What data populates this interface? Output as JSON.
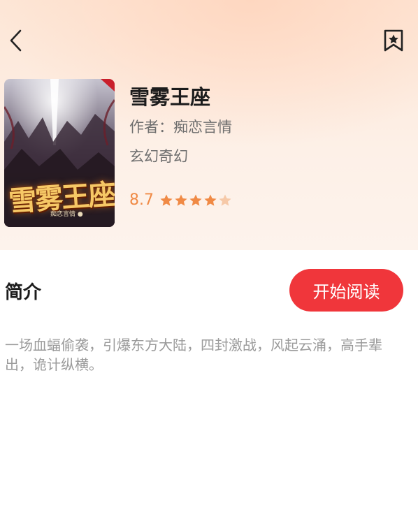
{
  "nav": {
    "back_icon": "chevron-left-icon",
    "bookmark_icon": "bookmark-star-icon"
  },
  "book": {
    "cover_title": "雪雾王座",
    "cover_author": "痴恋言情 ●",
    "title": "雪雾王座",
    "author": "作者：痴恋言情",
    "genre": "玄幻奇幻",
    "rating": "8.7",
    "stars_filled": 4,
    "stars_total": 5
  },
  "intro": {
    "heading": "简介",
    "text": "一场血蝠偷袭，引爆东方大陆，四封激战，风起云涌，高手辈出，诡计纵横。"
  },
  "actions": {
    "start_reading_label": "开始阅读"
  },
  "colors": {
    "accent_red": "#f0363b",
    "rating_orange": "#f08a45",
    "star_empty": "#f6c9a8"
  }
}
